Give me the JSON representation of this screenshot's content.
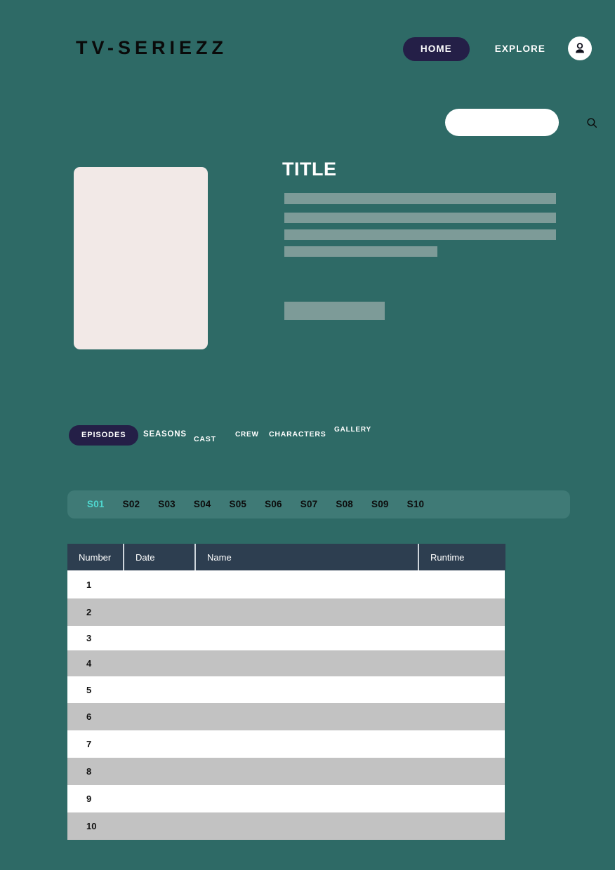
{
  "theme": {
    "background": "#2e6a66",
    "accent_navy": "#241f47",
    "season_bar": "#3f7a76",
    "active_season": "#4fd8d0",
    "skeleton": "#7d9b98",
    "table_header": "#2d3e50",
    "row_alt": "#c2c2c2",
    "poster": "#f2e9e7"
  },
  "header": {
    "logo": "TV-SERIEZZ",
    "nav": {
      "home": "HOME",
      "explore": "EXPLORE",
      "account_icon": "account-person-icon"
    }
  },
  "search": {
    "value": "",
    "placeholder": "",
    "icon": "search-icon"
  },
  "hero": {
    "poster_alt": "",
    "title": "TITLE",
    "skeleton_lines": 4,
    "skeleton_block": 1
  },
  "tabs": [
    {
      "label": "EPISODES",
      "active": true
    },
    {
      "label": "SEASONS",
      "active": false
    },
    {
      "label": "CAST",
      "active": false
    },
    {
      "label": "CREW",
      "active": false
    },
    {
      "label": "CHARACTERS",
      "active": false
    },
    {
      "label": "GALLERY",
      "active": false
    }
  ],
  "seasons": [
    {
      "label": "S01",
      "active": true
    },
    {
      "label": "S02",
      "active": false
    },
    {
      "label": "S03",
      "active": false
    },
    {
      "label": "S04",
      "active": false
    },
    {
      "label": "S05",
      "active": false
    },
    {
      "label": "S06",
      "active": false
    },
    {
      "label": "S07",
      "active": false
    },
    {
      "label": "S08",
      "active": false
    },
    {
      "label": "S09",
      "active": false
    },
    {
      "label": "S10",
      "active": false
    }
  ],
  "episodes_table": {
    "columns": [
      "Number",
      "Date",
      "Name",
      "Runtime"
    ],
    "rows": [
      {
        "number": "1",
        "date": "",
        "name": "",
        "runtime": ""
      },
      {
        "number": "2",
        "date": "",
        "name": "",
        "runtime": ""
      },
      {
        "number": "3",
        "date": "",
        "name": "",
        "runtime": ""
      },
      {
        "number": "4",
        "date": "",
        "name": "",
        "runtime": ""
      },
      {
        "number": "5",
        "date": "",
        "name": "",
        "runtime": ""
      },
      {
        "number": "6",
        "date": "",
        "name": "",
        "runtime": ""
      },
      {
        "number": "7",
        "date": "",
        "name": "",
        "runtime": ""
      },
      {
        "number": "8",
        "date": "",
        "name": "",
        "runtime": ""
      },
      {
        "number": "9",
        "date": "",
        "name": "",
        "runtime": ""
      },
      {
        "number": "10",
        "date": "",
        "name": "",
        "runtime": ""
      }
    ]
  }
}
